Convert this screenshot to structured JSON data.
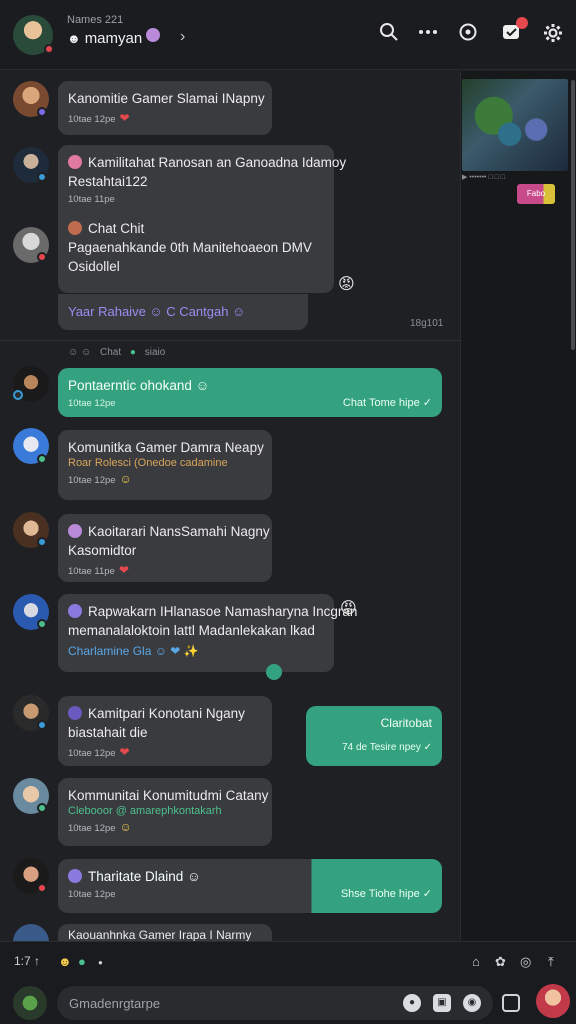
{
  "header": {
    "subtitle": "Names 221",
    "name": "mamyan",
    "name_emoji": "☻",
    "chevron": "›",
    "icons": [
      "search-icon",
      "more-icon",
      "status-icon",
      "notification-icon",
      "settings-icon"
    ]
  },
  "side": {
    "video_caption": "▶ ••••••• □ □ □",
    "tag_label": "Fabo"
  },
  "messages": [
    {
      "line1": "Kanomitie Gamer Slamai INapny",
      "meta": "10tae  12pe",
      "emoji": "❤"
    },
    {
      "line1": "Kamilitahat Ranosan an Ganoadna Idamoy",
      "line2": "Restahtai122",
      "meta": "10tae  11pe"
    },
    {
      "line1": "Chat Chit",
      "line2": "Pagaenahkande 0th Manitehoaeon DMV",
      "line3": "Osidollel"
    },
    {
      "line1": "Yaar Rahaive ☺ C Cantgah ☺"
    },
    {
      "line1": "Pontaerntic ohokand ☺",
      "meta": "10tae  12pe",
      "out": "Chat Tome hipe ✓"
    },
    {
      "line1": "Komunitka Gamer Damra Neapy",
      "sub": "Roar Rolesci (Onedoe cadamine",
      "meta": "10tae  12pe",
      "emoji": "☺"
    },
    {
      "line1": "Kaoitarari NansSamahi Nagny",
      "line2": "Kasomidtor",
      "meta": "10tae  11pe",
      "emoji": "❤"
    },
    {
      "line1": "Rapwakarn IHlanasoe Namasharyna Incgran",
      "line2": "memanalaloktoin lattl Madanlekakan lkad",
      "sub": "Charlamine Gla ☺ ❤ ✨"
    },
    {
      "line1": "Kamitpari Konotani Ngany",
      "line2": "biastahait die",
      "meta": "10tae  12pe",
      "emoji": "❤"
    },
    {
      "out_line": "Claritobat",
      "out_meta": "74 de Tesire npey ✓"
    },
    {
      "line1": "Kommunitai Konumitudmi Catany",
      "sub": "Clebooor @ amarephkontakarh",
      "meta": "10tae  12pe",
      "emoji": "☺"
    },
    {
      "line1": "Tharitate Dlaind ☺",
      "meta": "10tae  12pe",
      "out": "Shse Tiohe hipe ✓"
    },
    {
      "line1": "Kaouanhnka Gamer Irapa I Narmy"
    }
  ],
  "system_row": {
    "emojis": "☺ ☺",
    "label1": "Chat",
    "label2": "siaio"
  },
  "timestamp": "18g101",
  "composer": {
    "counter": "1:7 ↑",
    "placeholder": "Gmadenrgtarpe",
    "tools_right": [
      "home-icon",
      "sticker-icon",
      "camera-icon",
      "upload-icon"
    ]
  }
}
